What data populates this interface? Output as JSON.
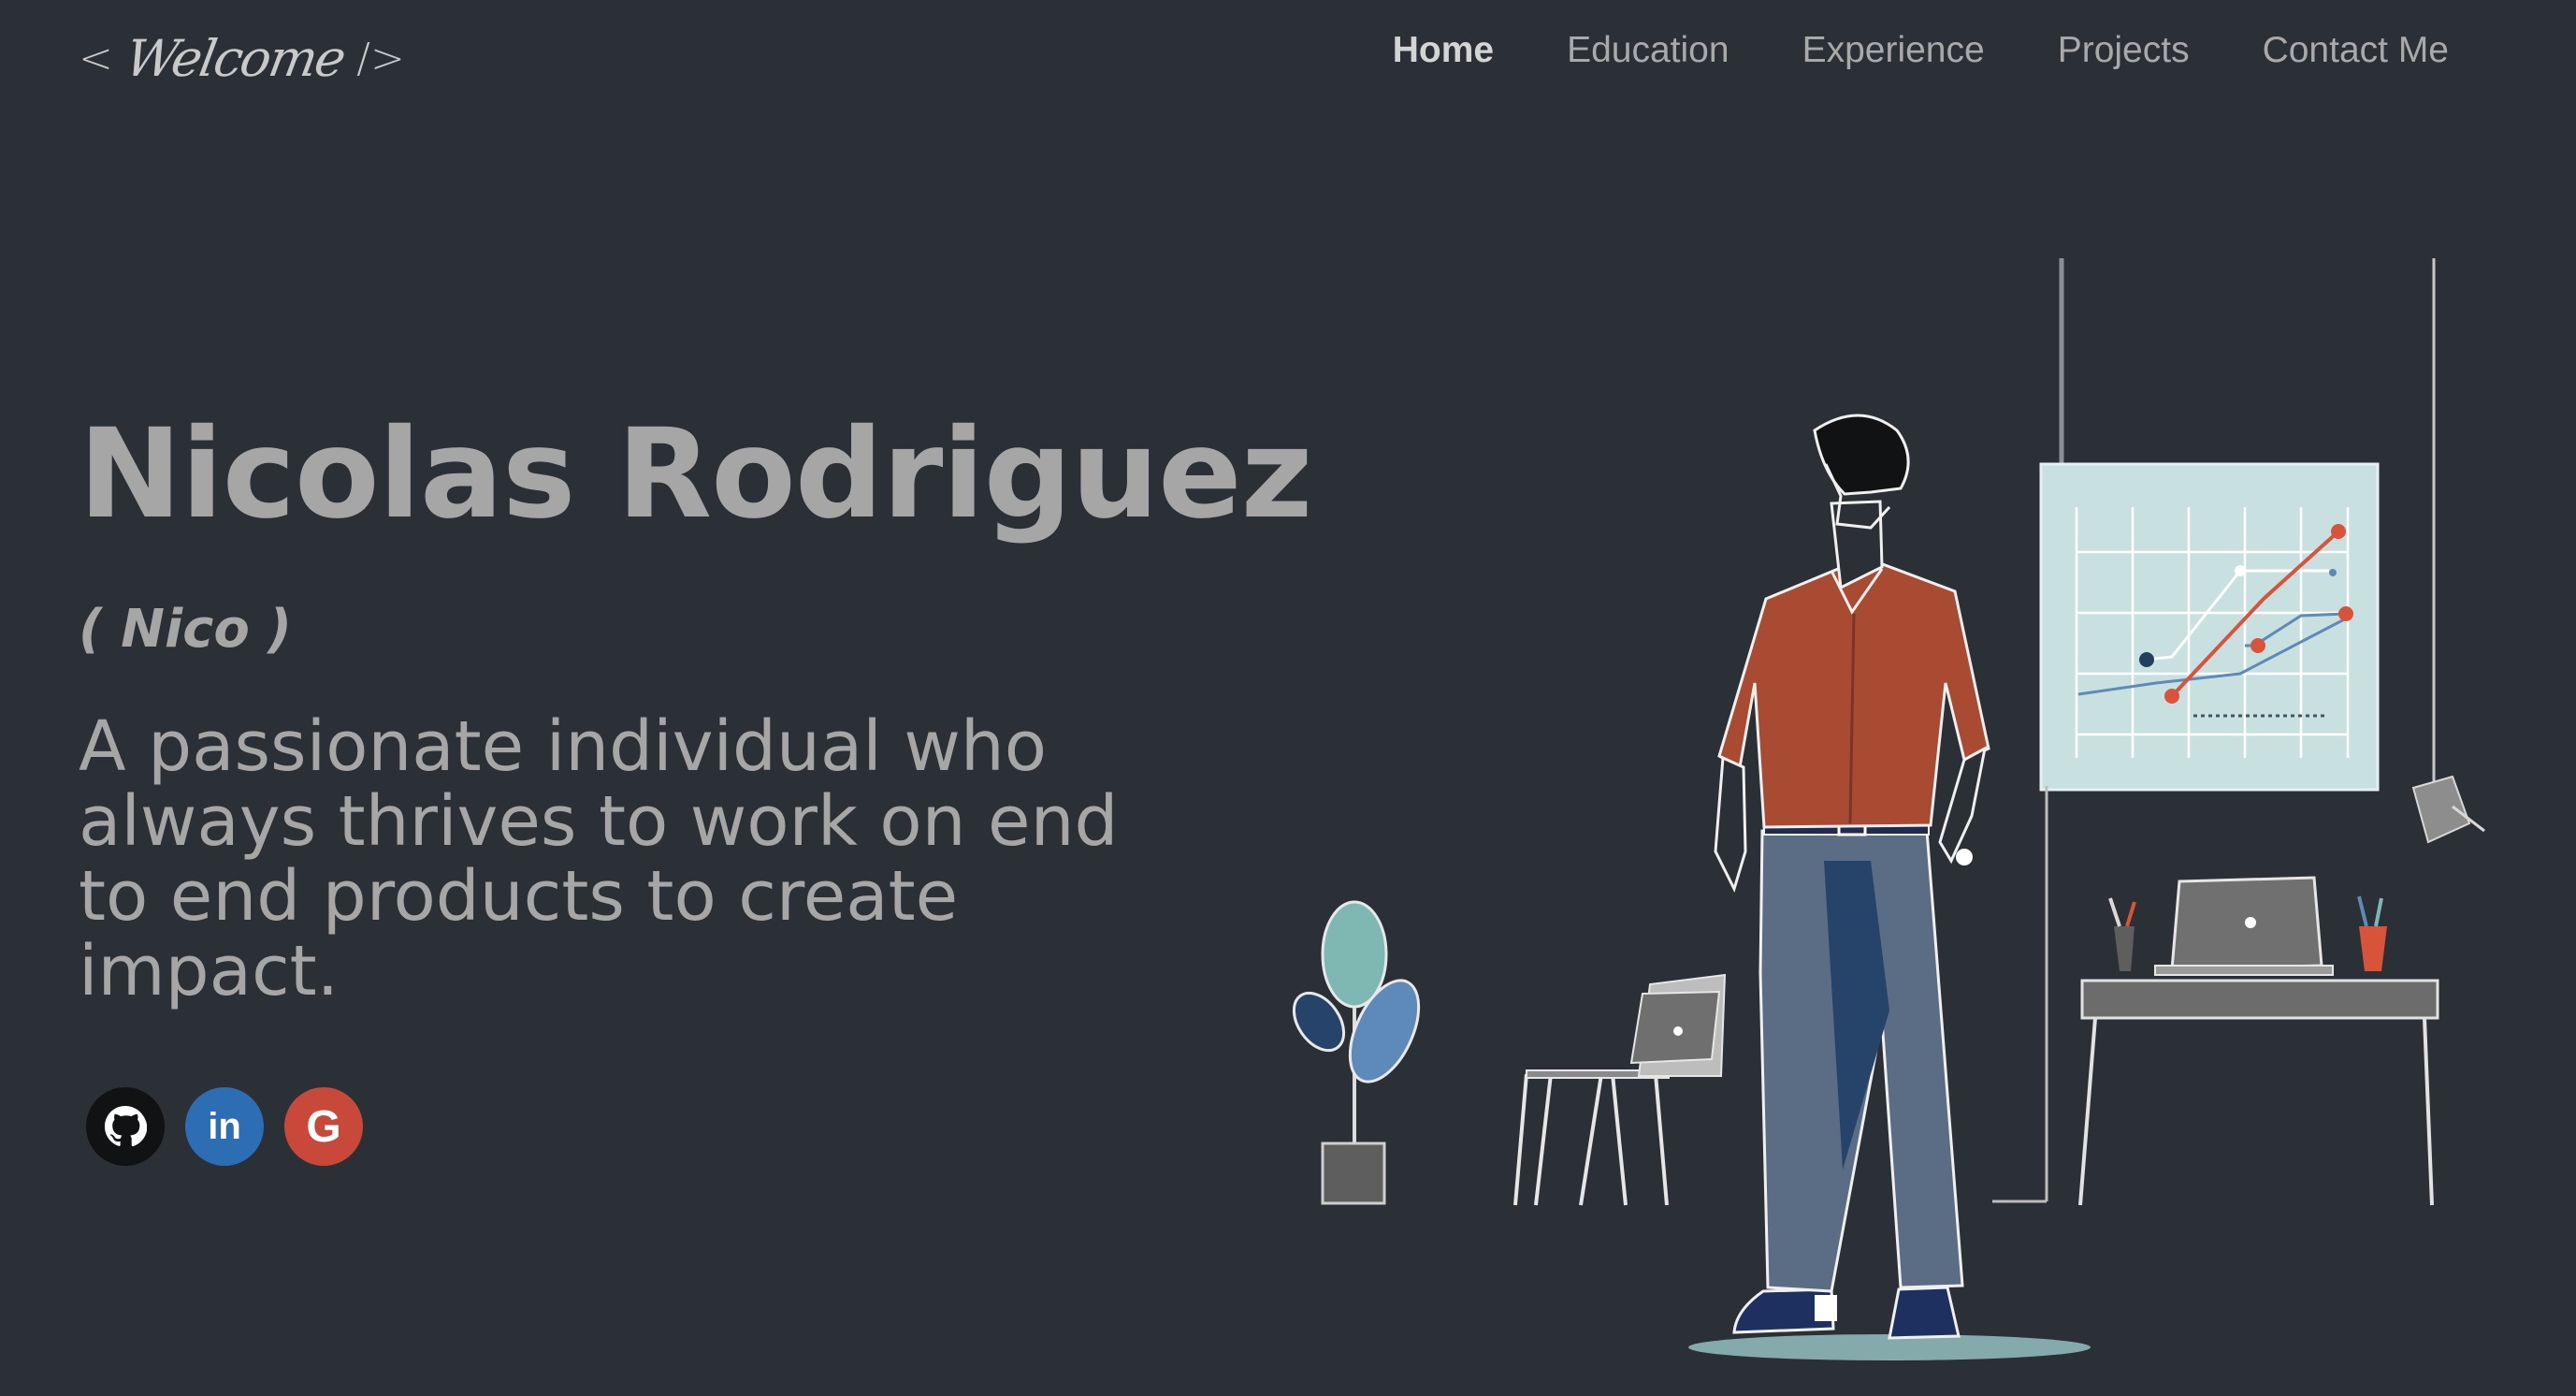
{
  "header": {
    "logo": {
      "open": "<",
      "script": "Welcome",
      "close": "/>"
    },
    "nav": [
      {
        "label": "Home",
        "active": true
      },
      {
        "label": "Education",
        "active": false
      },
      {
        "label": "Experience",
        "active": false
      },
      {
        "label": "Projects",
        "active": false
      },
      {
        "label": "Contact Me",
        "active": false
      }
    ]
  },
  "hero": {
    "name": "Nicolas Rodriguez",
    "nickname": "( Nico )",
    "tagline": "A passionate individual who always thrives to work on end to end products to create impact."
  },
  "socials": [
    {
      "name": "github",
      "icon": "github-icon",
      "color": "#111214"
    },
    {
      "name": "linkedin",
      "icon": "linkedin-icon",
      "label": "in",
      "color": "#2d6db3"
    },
    {
      "name": "google",
      "icon": "google-icon",
      "label": "G",
      "color": "#c8483a"
    }
  ],
  "colors": {
    "background": "#2a3036",
    "text": "#a6a6a6",
    "shirt": "#a94a33",
    "pants": "#5a6d85",
    "board": "#c8e0e0",
    "accent_red": "#d9533a",
    "accent_blue": "#5d8ab8",
    "plant": "#7fb8b2"
  }
}
